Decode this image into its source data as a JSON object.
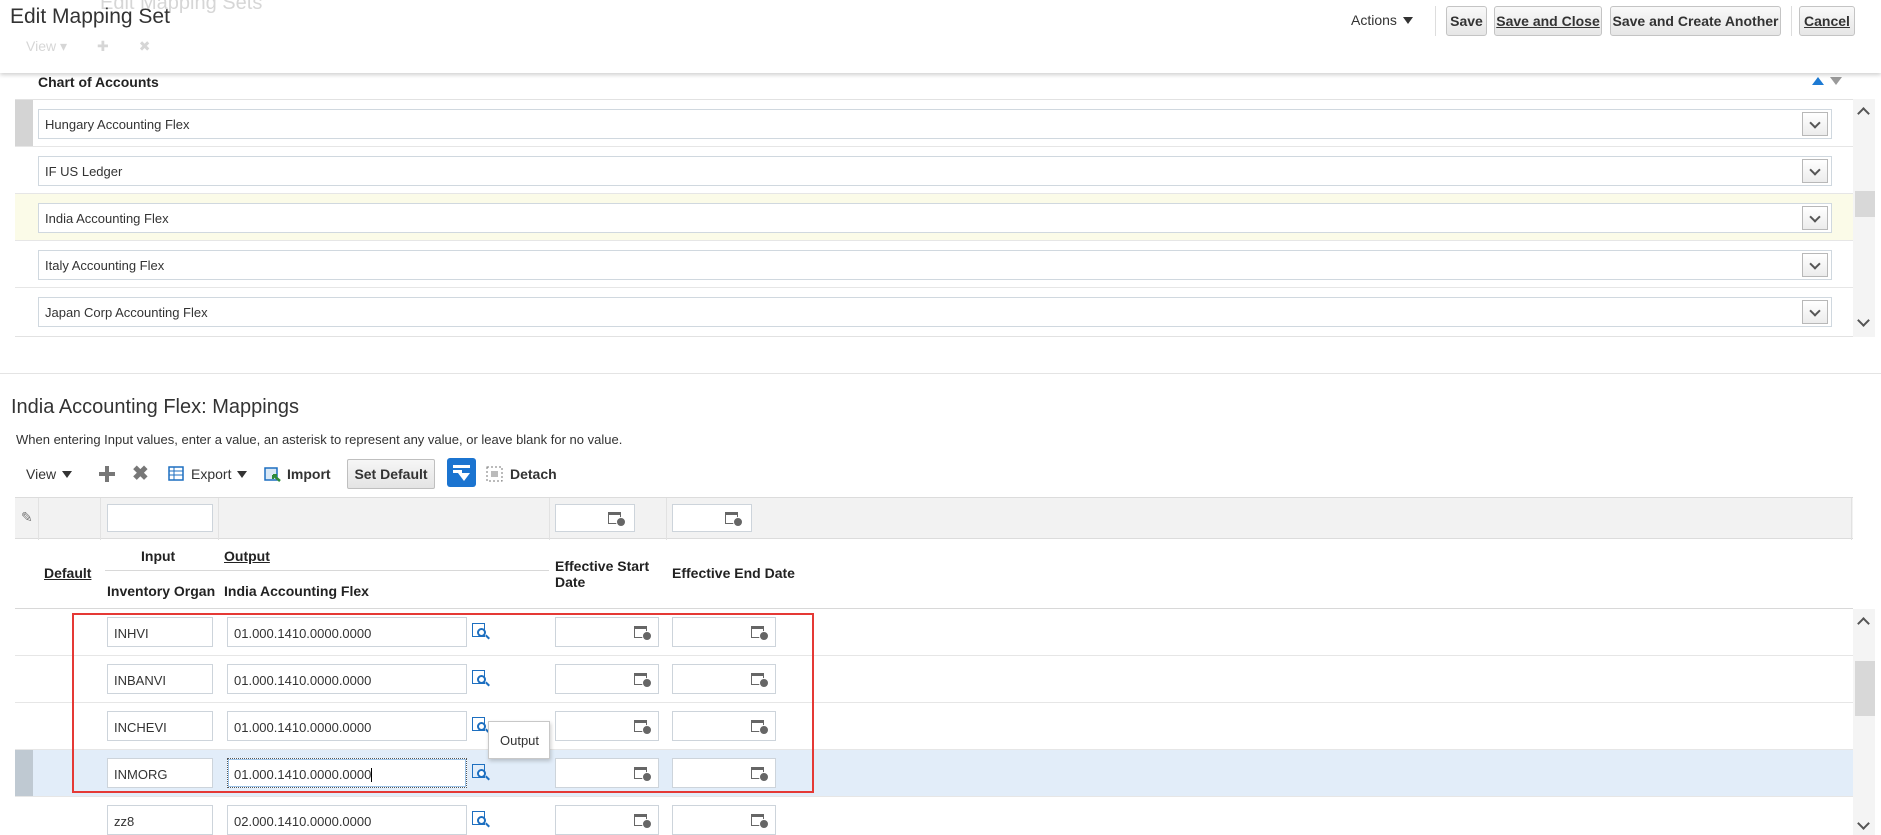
{
  "header": {
    "ghost_title": "Edit Mapping Sets",
    "ghost_toolbar_view": "View ▾",
    "title": "Edit Mapping Set",
    "actions_label": "Actions",
    "save_label": "Save",
    "save_close_label": "Save and Close",
    "save_create_label": "Save and Create Another",
    "cancel_label": "Cancel"
  },
  "chart_of_accounts": {
    "column_label": "Chart of Accounts",
    "rows": [
      {
        "value": "Hungary Accounting Flex"
      },
      {
        "value": "IF US Ledger"
      },
      {
        "value": "India Accounting Flex"
      },
      {
        "value": "Italy Accounting Flex"
      },
      {
        "value": "Japan Corp Accounting Flex"
      }
    ]
  },
  "mappings": {
    "title": "India Accounting Flex: Mappings",
    "help_text": "When entering Input values, enter a value, an asterisk to represent any value, or leave blank for no value.",
    "toolbar": {
      "view_label": "View",
      "export_label": "Export",
      "import_label": "Import",
      "set_default_label": "Set Default",
      "detach_label": "Detach"
    },
    "columns": {
      "default": "Default",
      "input_group": "Input",
      "input_col": "Inventory Organ",
      "output_group": "Output",
      "output_col": "India Accounting Flex",
      "start_date_line1": "Effective Start",
      "start_date_line2": "Date",
      "end_date": "Effective End Date"
    },
    "rows": [
      {
        "input": "INHVI",
        "output": "01.000.1410.0000.0000"
      },
      {
        "input": "INBANVI",
        "output": "01.000.1410.0000.0000"
      },
      {
        "input": "INCHEVI",
        "output": "01.000.1410.0000.0000"
      },
      {
        "input": "INMORG",
        "output": "01.000.1410.0000.0000"
      },
      {
        "input": "zz8",
        "output": "02.000.1410.0000.0000"
      }
    ],
    "tooltip": "Output"
  },
  "colors": {
    "accent": "#1b74d0",
    "highlight_border": "#e53935",
    "selected_row": "#e2edf9"
  }
}
